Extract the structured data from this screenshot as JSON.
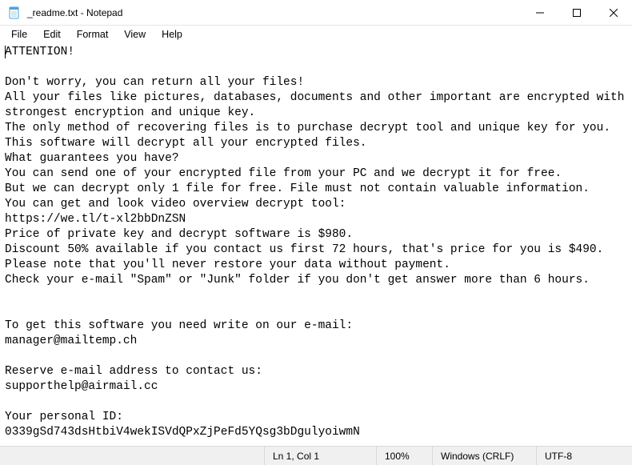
{
  "title": "_readme.txt - Notepad",
  "menu": {
    "file": "File",
    "edit": "Edit",
    "format": "Format",
    "view": "View",
    "help": "Help"
  },
  "body_text": "ATTENTION!\n\nDon't worry, you can return all your files!\nAll your files like pictures, databases, documents and other important are encrypted with strongest encryption and unique key.\nThe only method of recovering files is to purchase decrypt tool and unique key for you.\nThis software will decrypt all your encrypted files.\nWhat guarantees you have?\nYou can send one of your encrypted file from your PC and we decrypt it for free.\nBut we can decrypt only 1 file for free. File must not contain valuable information.\nYou can get and look video overview decrypt tool:\nhttps://we.tl/t-xl2bbDnZSN\nPrice of private key and decrypt software is $980.\nDiscount 50% available if you contact us first 72 hours, that's price for you is $490.\nPlease note that you'll never restore your data without payment.\nCheck your e-mail \"Spam\" or \"Junk\" folder if you don't get answer more than 6 hours.\n\n\nTo get this software you need write on our e-mail:\nmanager@mailtemp.ch\n\nReserve e-mail address to contact us:\nsupporthelp@airmail.cc\n\nYour personal ID:\n0339gSd743dsHtbiV4wekISVdQPxZjPeFd5YQsg3bDgulyoiwmN",
  "status": {
    "position": "Ln 1, Col 1",
    "zoom": "100%",
    "eol": "Windows (CRLF)",
    "encoding": "UTF-8"
  }
}
